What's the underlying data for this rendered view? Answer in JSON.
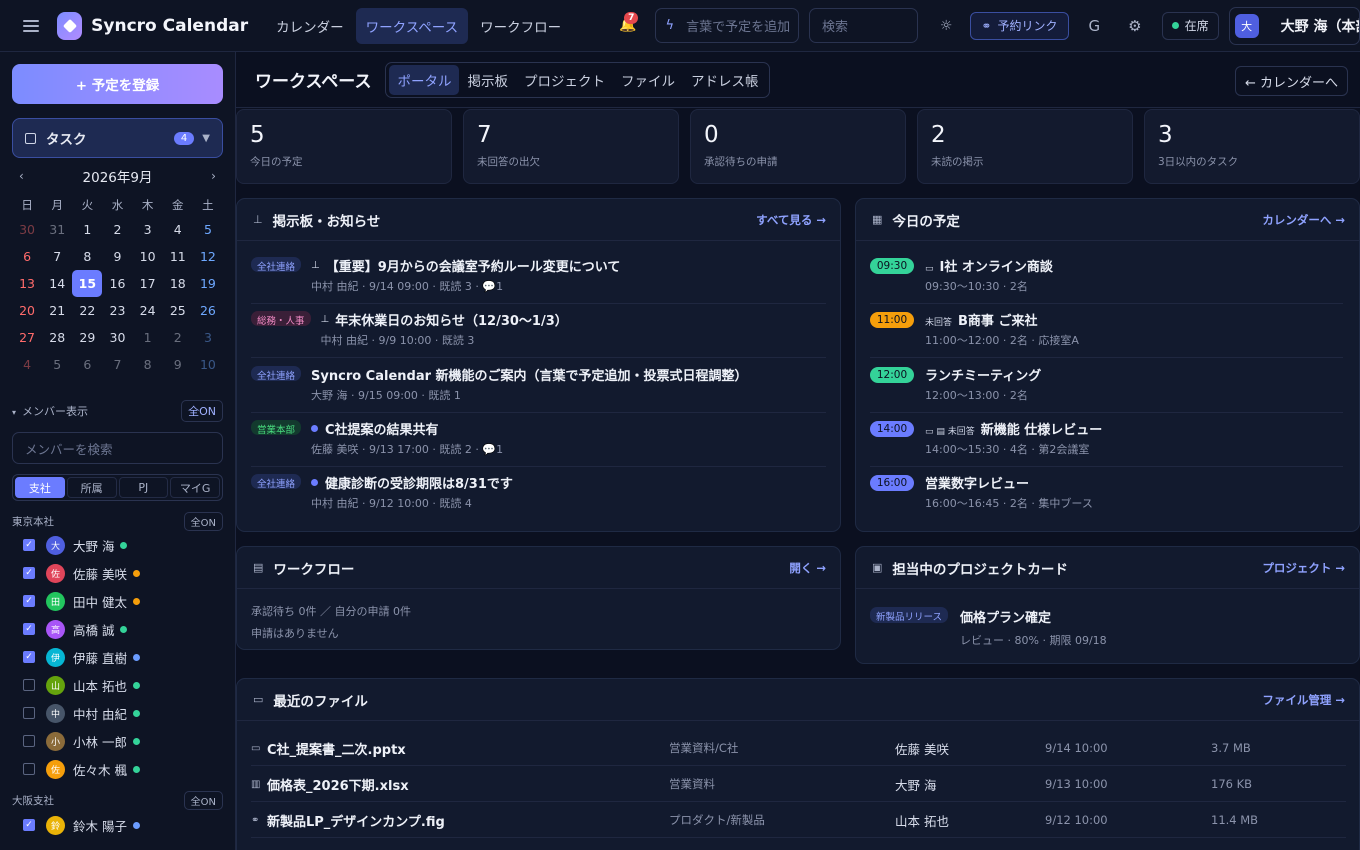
{
  "app": {
    "name": "Syncro Calendar",
    "nav": [
      "カレンダー",
      "ワークスペース",
      "ワークフロー"
    ],
    "notifications": "7",
    "quick_placeholder": "言葉で予定を追加",
    "search_placeholder": "検索",
    "booking_link": "予約リンク",
    "g_label": "G",
    "status": "在席",
    "user_initial": "大",
    "user_name": "大野 海（本部長"
  },
  "sidebar": {
    "add_button": "+ 予定を登録",
    "task_label": "タスク",
    "task_count": "4",
    "month": "2026年9月",
    "weekdays": [
      "日",
      "月",
      "火",
      "水",
      "木",
      "金",
      "土"
    ],
    "days": [
      [
        "30",
        "31",
        "1",
        "2",
        "3",
        "4",
        "5"
      ],
      [
        "6",
        "7",
        "8",
        "9",
        "10",
        "11",
        "12"
      ],
      [
        "13",
        "14",
        "15",
        "16",
        "17",
        "18",
        "19"
      ],
      [
        "20",
        "21",
        "22",
        "23",
        "24",
        "25",
        "26"
      ],
      [
        "27",
        "28",
        "29",
        "30",
        "1",
        "2",
        "3"
      ],
      [
        "4",
        "5",
        "6",
        "7",
        "8",
        "9",
        "10"
      ]
    ],
    "today": "15",
    "members_label": "メンバー表示",
    "all_on": "全ON",
    "member_search": "メンバーを検索",
    "segments": [
      "支社",
      "所属",
      "PJ",
      "マイG"
    ],
    "groups": [
      {
        "name": "東京本社",
        "all_on": "全ON"
      },
      {
        "name": "大阪支社",
        "all_on": "全ON"
      }
    ],
    "members": [
      {
        "initial": "大",
        "name": "大野 海",
        "checked": true,
        "color": "#4f5fe0",
        "status": "#34d399"
      },
      {
        "initial": "佐",
        "name": "佐藤 美咲",
        "checked": true,
        "color": "#e0455a",
        "status": "#f59e0b"
      },
      {
        "initial": "田",
        "name": "田中 健太",
        "checked": true,
        "color": "#22c55e",
        "status": "#f59e0b"
      },
      {
        "initial": "高",
        "name": "高橋 誠",
        "checked": true,
        "color": "#a855f7",
        "status": "#34d399"
      },
      {
        "initial": "伊",
        "name": "伊藤 直樹",
        "checked": true,
        "color": "#06b6d4",
        "status": "#6b9cff"
      },
      {
        "initial": "山",
        "name": "山本 拓也",
        "checked": false,
        "color": "#65a30d",
        "status": "#34d399"
      },
      {
        "initial": "中",
        "name": "中村 由紀",
        "checked": false,
        "color": "#475569",
        "status": "#34d399"
      },
      {
        "initial": "小",
        "name": "小林 一郎",
        "checked": false,
        "color": "#8b6b3a",
        "status": "#34d399"
      },
      {
        "initial": "佐",
        "name": "佐々木 楓",
        "checked": false,
        "color": "#f59e0b",
        "status": "#34d399"
      },
      {
        "initial": "鈴",
        "name": "鈴木 陽子",
        "checked": true,
        "color": "#eab308",
        "status": "#6b9cff"
      }
    ]
  },
  "workspace": {
    "title": "ワークスペース",
    "tabs": [
      "ポータル",
      "掲示板",
      "プロジェクト",
      "ファイル",
      "アドレス帳"
    ],
    "back": "← カレンダーへ"
  },
  "stats": [
    {
      "value": "5",
      "label": "今日の予定"
    },
    {
      "value": "7",
      "label": "未回答の出欠"
    },
    {
      "value": "0",
      "label": "承認待ちの申請"
    },
    {
      "value": "2",
      "label": "未読の掲示"
    },
    {
      "value": "3",
      "label": "3日以内のタスク"
    }
  ],
  "board": {
    "title": "掲示板・お知らせ",
    "link": "すべて見る →",
    "posts": [
      {
        "tag": "全社連絡",
        "tone": "blue",
        "title": "【重要】9月からの会議室予約ルール変更について",
        "meta": "中村 由紀 · 9/14 09:00 · 既読 3 · 💬1",
        "mark": "pin"
      },
      {
        "tag": "総務・人事",
        "tone": "pink",
        "title": "年末休業日のお知らせ（12/30〜1/3）",
        "meta": "中村 由紀 · 9/9 10:00 · 既読 3",
        "mark": "pin"
      },
      {
        "tag": "全社連絡",
        "tone": "blue",
        "title": "Syncro Calendar 新機能のご案内（言葉で予定追加・投票式日程調整）",
        "meta": "大野 海 · 9/15 09:00 · 既読 1",
        "mark": ""
      },
      {
        "tag": "営業本部",
        "tone": "green",
        "title": "C社提案の結果共有",
        "meta": "佐藤 美咲 · 9/13 17:00 · 既読 2 · 💬1",
        "mark": "dot"
      },
      {
        "tag": "全社連絡",
        "tone": "blue",
        "title": "健康診断の受診期限は8/31です",
        "meta": "中村 由紀 · 9/12 10:00 · 既読 4",
        "mark": "dot"
      }
    ]
  },
  "today": {
    "title": "今日の予定",
    "link": "カレンダーへ →",
    "events": [
      {
        "time": "09:30",
        "color": "#34d399",
        "title": "I社 オンライン商談",
        "meta": "09:30〜10:30 · 2名",
        "prefix": "▭"
      },
      {
        "time": "11:00",
        "color": "#f59e0b",
        "title": "B商事 ご来社",
        "meta": "11:00〜12:00 · 2名 · 応接室A",
        "prefix": "未回答"
      },
      {
        "time": "12:00",
        "color": "#34d399",
        "title": "ランチミーティング",
        "meta": "12:00〜13:00 · 2名",
        "prefix": ""
      },
      {
        "time": "14:00",
        "color": "#6b7cff",
        "title": "新機能 仕様レビュー",
        "meta": "14:00〜15:30 · 4名 · 第2会議室",
        "prefix": "▭ ▤ 未回答"
      },
      {
        "time": "16:00",
        "color": "#6b7cff",
        "title": "営業数字レビュー",
        "meta": "16:00〜16:45 · 2名 · 集中ブース",
        "prefix": ""
      }
    ]
  },
  "workflow": {
    "title": "ワークフロー",
    "link": "開く →",
    "summary": "承認待ち 0件 ／ 自分の申請 0件",
    "empty": "申請はありません"
  },
  "projects": {
    "title": "担当中のプロジェクトカード",
    "link": "プロジェクト →",
    "card": {
      "tag": "新製品リリース",
      "title": "価格プラン確定",
      "meta": "レビュー · 80% · 期限 09/18"
    }
  },
  "files": {
    "title": "最近のファイル",
    "link": "ファイル管理 →",
    "rows": [
      {
        "icon": "video",
        "name": "C社_提案書_二次.pptx",
        "path": "営業資料/C社",
        "owner": "佐藤 美咲",
        "date": "9/14 10:00",
        "size": "3.7 MB"
      },
      {
        "icon": "chart",
        "name": "価格表_2026下期.xlsx",
        "path": "営業資料",
        "owner": "大野 海",
        "date": "9/13 10:00",
        "size": "176 KB"
      },
      {
        "icon": "link",
        "name": "新製品LP_デザインカンプ.fig",
        "path": "プロダクト/新製品",
        "owner": "山本 拓也",
        "date": "9/12 10:00",
        "size": "11.4 MB"
      }
    ]
  }
}
